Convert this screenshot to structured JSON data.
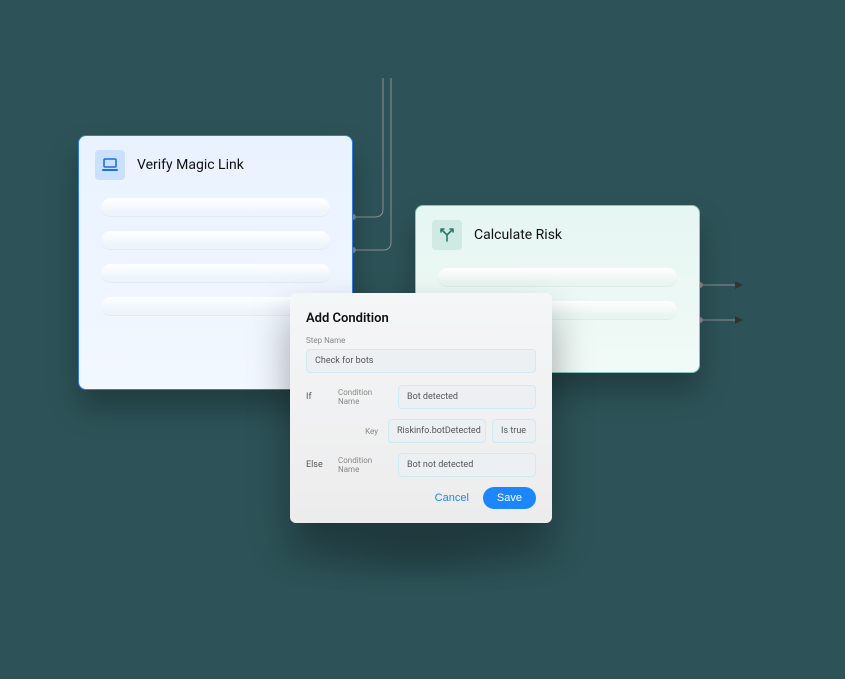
{
  "card1": {
    "title": "Verify Magic Link",
    "icon": "laptop-icon"
  },
  "card2": {
    "title": "Calculate Risk",
    "icon": "split-icon"
  },
  "modal": {
    "title": "Add Condition",
    "step_name_label": "Step Name",
    "step_name_value": "Check for bots",
    "if_label": "If",
    "else_label": "Else",
    "condition_name_label": "Condition Name",
    "if_condition_value": "Bot detected",
    "key_label": "Key",
    "key_value": "Riskinfo.botDetected",
    "key_op": "Is true",
    "else_condition_value": "Bot not detected",
    "cancel_label": "Cancel",
    "save_label": "Save"
  }
}
